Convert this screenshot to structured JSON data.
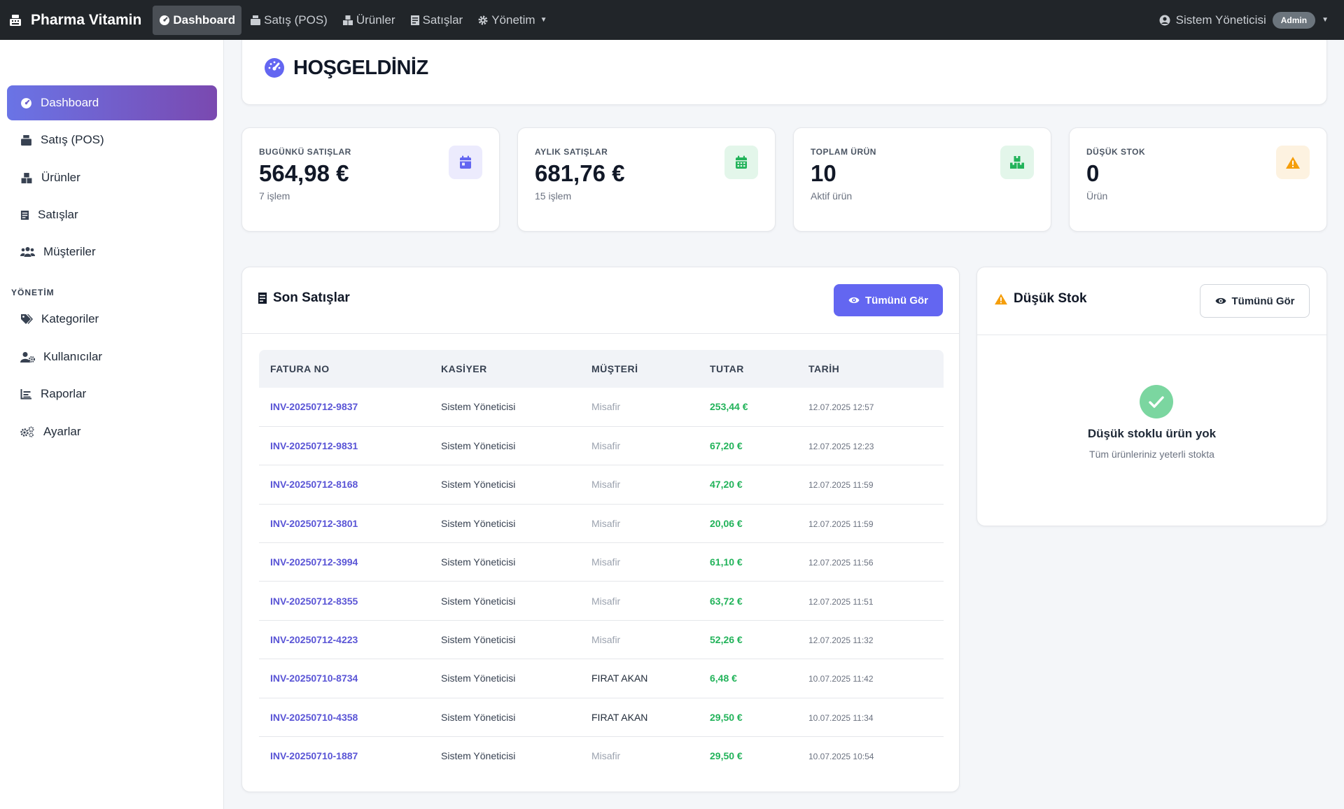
{
  "navbar": {
    "brand": "Pharma Vitamin",
    "items": [
      {
        "label": "Dashboard"
      },
      {
        "label": "Satış (POS)"
      },
      {
        "label": "Ürünler"
      },
      {
        "label": "Satışlar"
      },
      {
        "label": "Yönetim"
      }
    ],
    "user_name": "Sistem Yöneticisi",
    "user_role": "Admin"
  },
  "sidebar": {
    "items": [
      {
        "label": "Dashboard"
      },
      {
        "label": "Satış (POS)"
      },
      {
        "label": "Ürünler"
      },
      {
        "label": "Satışlar"
      },
      {
        "label": "Müşteriler"
      }
    ],
    "section_heading": "YÖNETİM",
    "admin_items": [
      {
        "label": "Kategoriler"
      },
      {
        "label": "Kullanıcılar"
      },
      {
        "label": "Raporlar"
      },
      {
        "label": "Ayarlar"
      }
    ]
  },
  "welcome": {
    "title": "HOŞGELDİNİZ"
  },
  "stats": [
    {
      "label": "BUGÜNKÜ SATIŞLAR",
      "value": "564,98 €",
      "sub": "7 işlem",
      "color": "#6366f1",
      "icon": "calendar-day-icon"
    },
    {
      "label": "AYLIK SATIŞLAR",
      "value": "681,76 €",
      "sub": "15 işlem",
      "color": "#22b35a",
      "icon": "calendar-month-icon"
    },
    {
      "label": "TOPLAM ÜRÜN",
      "value": "10",
      "sub": "Aktif ürün",
      "color": "#22b35a",
      "icon": "boxes-icon"
    },
    {
      "label": "DÜŞÜK STOK",
      "value": "0",
      "sub": "Ürün",
      "color": "#f59e0b",
      "icon": "warning-icon"
    }
  ],
  "recent_sales": {
    "title": "Son Satışlar",
    "view_all": "Tümünü Gör",
    "columns": [
      "FATURA NO",
      "KASİYER",
      "MÜŞTERİ",
      "TUTAR",
      "TARİH"
    ],
    "rows": [
      {
        "invoice": "INV-20250712-9837",
        "cashier": "Sistem Yöneticisi",
        "customer": "Misafir",
        "guest": true,
        "amount": "253,44 €",
        "date": "12.07.2025 12:57"
      },
      {
        "invoice": "INV-20250712-9831",
        "cashier": "Sistem Yöneticisi",
        "customer": "Misafir",
        "guest": true,
        "amount": "67,20 €",
        "date": "12.07.2025 12:23"
      },
      {
        "invoice": "INV-20250712-8168",
        "cashier": "Sistem Yöneticisi",
        "customer": "Misafir",
        "guest": true,
        "amount": "47,20 €",
        "date": "12.07.2025 11:59"
      },
      {
        "invoice": "INV-20250712-3801",
        "cashier": "Sistem Yöneticisi",
        "customer": "Misafir",
        "guest": true,
        "amount": "20,06 €",
        "date": "12.07.2025 11:59"
      },
      {
        "invoice": "INV-20250712-3994",
        "cashier": "Sistem Yöneticisi",
        "customer": "Misafir",
        "guest": true,
        "amount": "61,10 €",
        "date": "12.07.2025 11:56"
      },
      {
        "invoice": "INV-20250712-8355",
        "cashier": "Sistem Yöneticisi",
        "customer": "Misafir",
        "guest": true,
        "amount": "63,72 €",
        "date": "12.07.2025 11:51"
      },
      {
        "invoice": "INV-20250712-4223",
        "cashier": "Sistem Yöneticisi",
        "customer": "Misafir",
        "guest": true,
        "amount": "52,26 €",
        "date": "12.07.2025 11:32"
      },
      {
        "invoice": "INV-20250710-8734",
        "cashier": "Sistem Yöneticisi",
        "customer": "FIRAT AKAN",
        "guest": false,
        "amount": "6,48 €",
        "date": "10.07.2025 11:42"
      },
      {
        "invoice": "INV-20250710-4358",
        "cashier": "Sistem Yöneticisi",
        "customer": "FIRAT AKAN",
        "guest": false,
        "amount": "29,50 €",
        "date": "10.07.2025 11:34"
      },
      {
        "invoice": "INV-20250710-1887",
        "cashier": "Sistem Yöneticisi",
        "customer": "Misafir",
        "guest": true,
        "amount": "29,50 €",
        "date": "10.07.2025 10:54"
      }
    ]
  },
  "low_stock": {
    "title": "Düşük Stok",
    "view_all": "Tümünü Gör",
    "empty_title": "Düşük stoklu ürün yok",
    "empty_sub": "Tüm ürünleriniz yeterli stokta"
  }
}
